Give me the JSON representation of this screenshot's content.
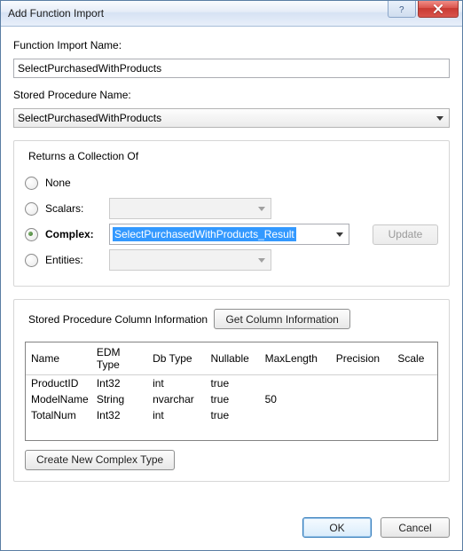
{
  "window": {
    "title": "Add Function Import",
    "help_icon": "help-icon",
    "close_icon": "close-icon"
  },
  "functionImport": {
    "label": "Function Import Name:",
    "value": "SelectPurchasedWithProducts"
  },
  "storedProcedure": {
    "label": "Stored Procedure Name:",
    "value": "SelectPurchasedWithProducts"
  },
  "returns": {
    "legend": "Returns a Collection Of",
    "options": {
      "none": {
        "label": "None",
        "checked": false
      },
      "scalars": {
        "label": "Scalars:",
        "checked": false,
        "combo": ""
      },
      "complex": {
        "label": "Complex:",
        "checked": true,
        "combo": "SelectPurchasedWithProducts_Result",
        "updateBtn": "Update"
      },
      "entities": {
        "label": "Entities:",
        "checked": false,
        "combo": ""
      }
    }
  },
  "columns": {
    "legend": "Stored Procedure Column Information",
    "getInfoBtn": "Get Column Information",
    "createComplexBtn": "Create New Complex Type",
    "headers": {
      "name": "Name",
      "edm": "EDM Type",
      "db": "Db Type",
      "nullable": "Nullable",
      "maxlength": "MaxLength",
      "precision": "Precision",
      "scale": "Scale"
    },
    "rows": [
      {
        "name": "ProductID",
        "edm": "Int32",
        "db": "int",
        "nullable": "true",
        "maxlength": "",
        "precision": "",
        "scale": ""
      },
      {
        "name": "ModelName",
        "edm": "String",
        "db": "nvarchar",
        "nullable": "true",
        "maxlength": "50",
        "precision": "",
        "scale": ""
      },
      {
        "name": "TotalNum",
        "edm": "Int32",
        "db": "int",
        "nullable": "true",
        "maxlength": "",
        "precision": "",
        "scale": ""
      }
    ]
  },
  "footer": {
    "ok": "OK",
    "cancel": "Cancel"
  }
}
